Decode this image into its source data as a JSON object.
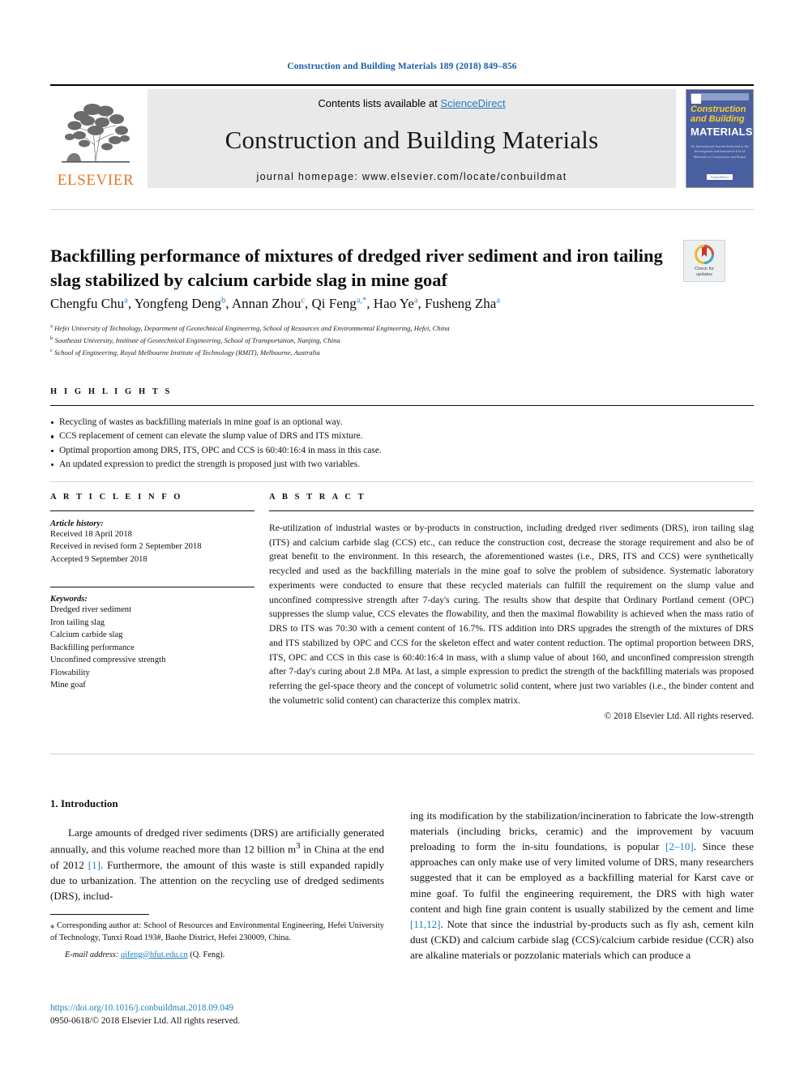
{
  "running_head": "Construction and Building Materials 189 (2018) 849–856",
  "masthead": {
    "contents_prefix": "Contents lists available at ",
    "sciencedirect": "ScienceDirect",
    "journal_name": "Construction and Building Materials",
    "homepage": "journal homepage: www.elsevier.com/locate/conbuildmat",
    "publisher": "ELSEVIER",
    "cover": {
      "line1": "Construction",
      "line2": "and Building",
      "line3": "MATERIALS",
      "blurb": "An International Journal dedicated to the Investigation and Innovative Use of Materials in Construction and Repair",
      "footer": "ScienceDirect"
    }
  },
  "article": {
    "title": "Backfilling performance of mixtures of dredged river sediment and iron tailing slag stabilized by calcium carbide slag in mine goaf",
    "crossmark": {
      "line1": "Check for",
      "line2": "updates"
    },
    "authors": [
      {
        "name": "Chengfu Chu",
        "sup": "a",
        "sep": ", "
      },
      {
        "name": "Yongfeng Deng",
        "sup": "b",
        "sep": ", "
      },
      {
        "name": "Annan Zhou",
        "sup": "c",
        "sep": ", "
      },
      {
        "name": "Qi Feng",
        "sup": "a,*",
        "sep": ", "
      },
      {
        "name": "Hao Ye",
        "sup": "a",
        "sep": ", "
      },
      {
        "name": "Fusheng Zha",
        "sup": "a",
        "sep": ""
      }
    ],
    "affiliations": [
      {
        "mark": "a",
        "text": "Hefei University of Technology, Department of Geotechnical Engineering, School of Resources and Environmental Engineering, Hefei, China"
      },
      {
        "mark": "b",
        "text": "Southeast University, Institute of Geotechnical Engineering, School of Transportation, Nanjing, China"
      },
      {
        "mark": "c",
        "text": "School of Engineering, Royal Melbourne Institute of Technology (RMIT), Melbourne, Australia"
      }
    ]
  },
  "highlights": {
    "heading": "H I G H L I G H T S",
    "items": [
      "Recycling of wastes as backfilling materials in mine goaf is an optional way.",
      "CCS replacement of cement can elevate the slump value of DRS and ITS mixture.",
      "Optimal proportion among DRS, ITS, OPC and CCS is 60:40:16:4 in mass in this case.",
      "An updated expression to predict the strength is proposed just with two variables."
    ]
  },
  "article_info": {
    "heading": "A R T I C L E  I N F O",
    "history_label": "Article history:",
    "history": [
      "Received 18 April 2018",
      "Received in revised form 2 September 2018",
      "Accepted 9 September 2018"
    ],
    "keywords_label": "Keywords:",
    "keywords": [
      "Dredged river sediment",
      "Iron tailing slag",
      "Calcium carbide slag",
      "Backfilling performance",
      "Unconfined compressive strength",
      "Flowability",
      "Mine goaf"
    ]
  },
  "abstract": {
    "heading": "A B S T R A C T",
    "text": "Re-utilization of industrial wastes or by-products in construction, including dredged river sediments (DRS), iron tailing slag (ITS) and calcium carbide slag (CCS) etc., can reduce the construction cost, decrease the storage requirement and also be of great benefit to the environment. In this research, the aforementioned wastes (i.e., DRS, ITS and CCS) were synthetically recycled and used as the backfilling materials in the mine goaf to solve the problem of subsidence. Systematic laboratory experiments were conducted to ensure that these recycled materials can fulfill the requirement on the slump value and unconfined compressive strength after 7-day's curing. The results show that despite that Ordinary Portland cement (OPC) suppresses the slump value, CCS elevates the flowability, and then the maximal flowability is achieved when the mass ratio of DRS to ITS was 70:30 with a cement content of 16.7%. ITS addition into DRS upgrades the strength of the mixtures of DRS and ITS stabilized by OPC and CCS for the skeleton effect and water content reduction. The optimal proportion between DRS, ITS, OPC and CCS in this case is 60:40:16:4 in mass, with a slump value of about 160, and unconfined compression strength after 7-day's curing about 2.8 MPa. At last, a simple expression to predict the strength of the backfilling materials was proposed referring the gel-space theory and the concept of volumetric solid content, where just two variables (i.e., the binder content and the volumetric solid content) can characterize this complex matrix.",
    "copyright": "© 2018 Elsevier Ltd. All rights reserved."
  },
  "body": {
    "section_heading": "1. Introduction",
    "left_paragraph_parts": {
      "p1a": "Large amounts of dredged river sediments (DRS) are artificially generated annually, and this volume reached more than 12 billion m",
      "p1_sup": "3",
      "p1b": " in China at the end of 2012 ",
      "p1_ref": "[1]",
      "p1c": ". Furthermore, the amount of this waste is still expanded rapidly due to urbanization. The attention on the recycling use of dredged sediments (DRS), includ-"
    },
    "right_paragraph_parts": {
      "p2a": "ing its modification by the stabilization/incineration to fabricate the low-strength materials (including bricks, ceramic) and the improvement by vacuum preloading to form the in-situ foundations, is popular ",
      "p2_ref1": "[2–10]",
      "p2b": ". Since these approaches can only make use of very limited volume of DRS, many researchers suggested that it can be employed as a backfilling material for Karst cave or mine goaf. To fulfil the engineering requirement, the DRS with high water content and high fine grain content is usually stabilized by the cement and lime ",
      "p2_ref2": "[11,12]",
      "p2c": ". Note that since the industrial by-products such as fly ash, cement kiln dust (CKD) and calcium carbide slag (CCS)/calcium carbide residue (CCR) also are alkaline materials or pozzolanic materials which can produce a"
    }
  },
  "footnotes": {
    "corresponding": "⁎ Corresponding author at: School of Resources and Environmental Engineering, Hefei University of Technology, Tunxi Road 193#, Baohe District, Hefei 230009, China.",
    "email_label": "E-mail address:",
    "email": "qifeng@hfut.edu.cn",
    "email_suffix": " (Q. Feng).",
    "doi": "https://doi.org/10.1016/j.conbuildmat.2018.09.049",
    "issn": "0950-0618/© 2018 Elsevier Ltd. All rights reserved."
  },
  "colors": {
    "link": "#1a7fbd",
    "running_head": "#1a5fa8",
    "elsevier_orange": "#e87722",
    "cover_blue": "#4a5fa0"
  }
}
